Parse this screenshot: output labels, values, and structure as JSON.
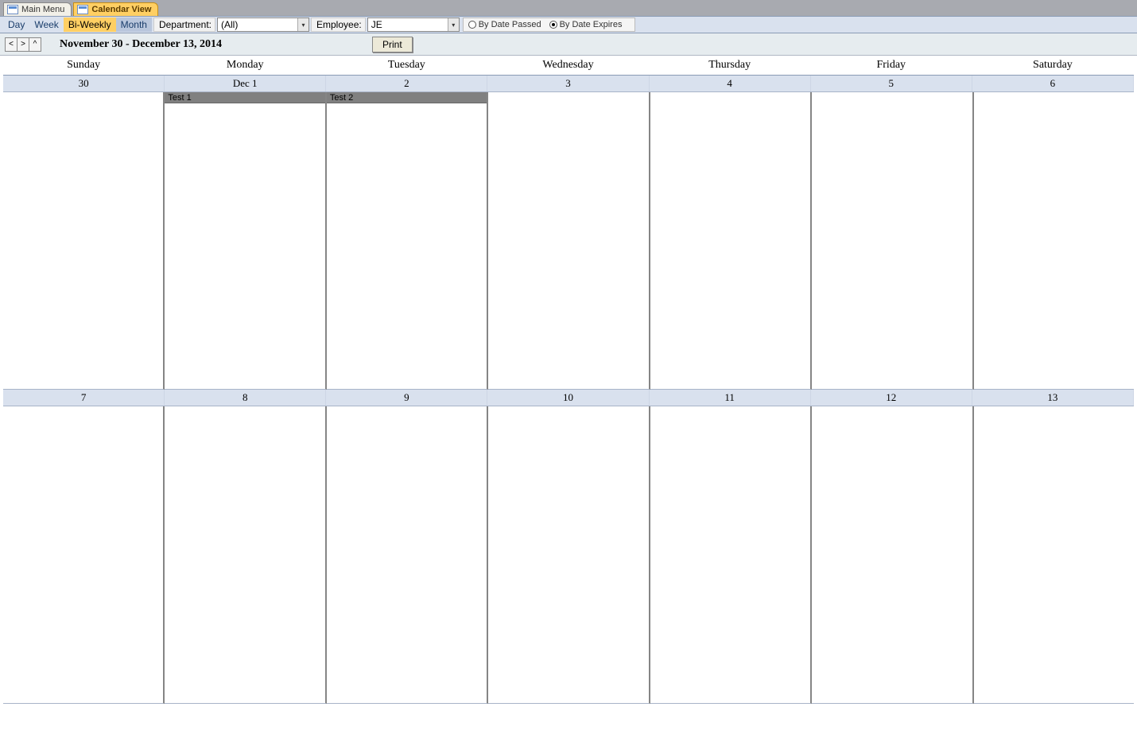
{
  "tabs": {
    "main_menu": "Main Menu",
    "calendar_view": "Calendar View"
  },
  "toolbar": {
    "views": {
      "day": "Day",
      "week": "Week",
      "biweekly": "Bi-Weekly",
      "month": "Month"
    },
    "department_label": "Department:",
    "department_value": "(All)",
    "employee_label": "Employee:",
    "employee_value": "JE",
    "radio_passed": "By Date Passed",
    "radio_expires": "By Date Expires"
  },
  "nav": {
    "prev": "<",
    "next": ">",
    "up": "^",
    "date_range": "November 30 - December 13, 2014",
    "print": "Print"
  },
  "day_headers": [
    "Sunday",
    "Monday",
    "Tuesday",
    "Wednesday",
    "Thursday",
    "Friday",
    "Saturday"
  ],
  "week1": {
    "dates": [
      "30",
      "Dec 1",
      "2",
      "3",
      "4",
      "5",
      "6"
    ],
    "events": {
      "1": "Test 1",
      "2": "Test 2"
    }
  },
  "week2": {
    "dates": [
      "7",
      "8",
      "9",
      "10",
      "11",
      "12",
      "13"
    ]
  }
}
